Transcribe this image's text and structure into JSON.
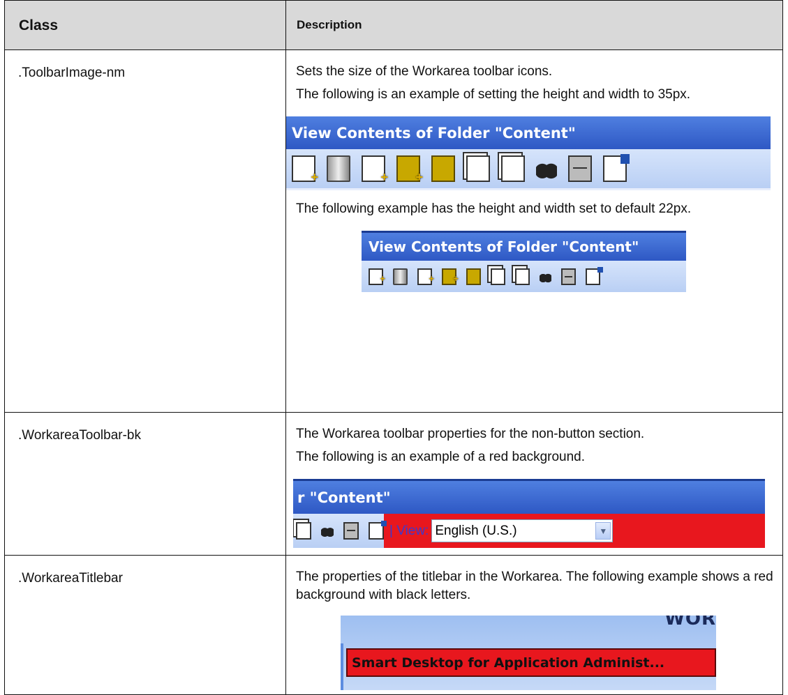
{
  "table": {
    "header": {
      "class_label": "Class",
      "description_label": "Description"
    },
    "rows": [
      {
        "class_name": ".ToolbarImage-nm",
        "desc1": "Sets the size of the Workarea toolbar icons.",
        "desc2": "The following is an example of setting the height and width to 35px.",
        "fig1_title": "View Contents of Folder \"Content\"",
        "desc3": "The following example has the height and width set to default 22px.",
        "fig2_title": "View Contents of Folder \"Content\""
      },
      {
        "class_name": ".WorkareaToolbar-bk",
        "desc1": "The Workarea toolbar properties for the non-button section.",
        "desc2": "The following is an example of a red background.",
        "fig_title": "r \"Content\"",
        "view_label": "| View:",
        "language_value": "English (U.S.)"
      },
      {
        "class_name": ".WorkareaTitlebar",
        "desc1": "The properties of the titlebar in the Workarea. The following example shows a red background with black letters.",
        "fig_top_text": "WOR",
        "fig_bar_text": "Smart Desktop for Application Administ..."
      }
    ]
  },
  "toolbar_icons": [
    "new-content-icon",
    "delete-content-icon",
    "add-folder-icon",
    "add-subfolder-icon",
    "delete-folder-icon",
    "copy-icon",
    "move-icon",
    "search-icon",
    "archive-icon",
    "properties-icon"
  ],
  "colors": {
    "titlebar": "#2e58c4",
    "toolbar": "#c6d8f7",
    "red_background": "#e8171e"
  }
}
